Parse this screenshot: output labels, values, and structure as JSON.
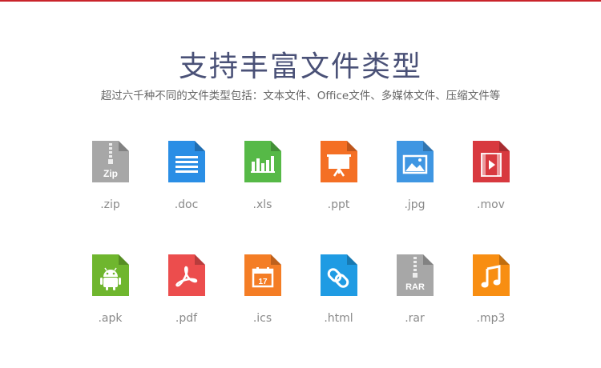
{
  "header": {
    "title": "支持丰富文件类型",
    "subtitle": "超过六千种不同的文件类型包括：文本文件、Office文件、多媒体文件、压缩文件等"
  },
  "file_types": [
    {
      "ext": ".zip",
      "icon": "zip-file-icon",
      "color": "#a7a7a7"
    },
    {
      "ext": ".doc",
      "icon": "doc-file-icon",
      "color": "#2a8ee5"
    },
    {
      "ext": ".xls",
      "icon": "xls-file-icon",
      "color": "#56b947"
    },
    {
      "ext": ".ppt",
      "icon": "ppt-file-icon",
      "color": "#f46f24"
    },
    {
      "ext": ".jpg",
      "icon": "jpg-file-icon",
      "color": "#3f96e2"
    },
    {
      "ext": ".mov",
      "icon": "mov-file-icon",
      "color": "#d8393f"
    },
    {
      "ext": ".apk",
      "icon": "apk-file-icon",
      "color": "#6fb62e"
    },
    {
      "ext": ".pdf",
      "icon": "pdf-file-icon",
      "color": "#ec4d4d"
    },
    {
      "ext": ".ics",
      "icon": "ics-file-icon",
      "color": "#f47d25"
    },
    {
      "ext": ".html",
      "icon": "html-file-icon",
      "color": "#1f9be3"
    },
    {
      "ext": ".rar",
      "icon": "rar-file-icon",
      "color": "#a7a7a7"
    },
    {
      "ext": ".mp3",
      "icon": "mp3-file-icon",
      "color": "#f88e12"
    }
  ],
  "icon_labels": {
    "zip": "Zip",
    "ics": "17",
    "rar": "RAR"
  }
}
